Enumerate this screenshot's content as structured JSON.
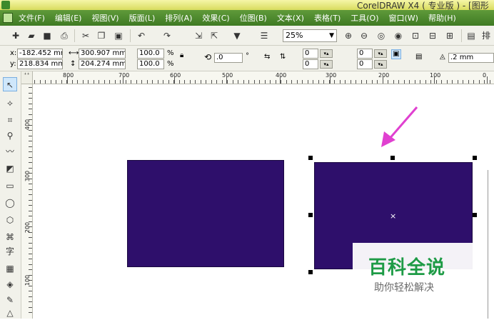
{
  "window": {
    "title": "CorelDRAW X4 ( 专业版 ) - [图形"
  },
  "menu": [
    "文件(F)",
    "编辑(E)",
    "视图(V)",
    "版面(L)",
    "排列(A)",
    "效果(C)",
    "位图(B)",
    "文本(X)",
    "表格(T)",
    "工具(O)",
    "窗口(W)",
    "帮助(H)"
  ],
  "toolbar": {
    "zoom": "25%",
    "trailing_label": "排"
  },
  "property_bar": {
    "x_label": "x:",
    "x_value": "-182.452 mm",
    "y_label": "y:",
    "y_value": "218.834 mm",
    "width_value": "300.907 mm",
    "height_value": "204.274 mm",
    "scale_w": "100.0",
    "scale_h": "100.0",
    "percent": "%",
    "rotation": ".0",
    "degree": "°",
    "corner_1": "0",
    "corner_2": "0",
    "corner_3": "0",
    "corner_4": "0",
    "outline_width": ".2 mm"
  },
  "rulers": {
    "horizontal": [
      "800",
      "700",
      "600",
      "500",
      "400",
      "300",
      "200",
      "100",
      "0"
    ],
    "vertical": [
      "400",
      "300",
      "200",
      "100"
    ]
  },
  "watermark": {
    "title": "百科全说",
    "subtitle": "助你轻松解决"
  },
  "colors": {
    "shape_fill": "#2e0f6b",
    "menu_bar": "#4a8a2c",
    "arrow": "#e040d0",
    "watermark_title": "#1e9b46"
  }
}
